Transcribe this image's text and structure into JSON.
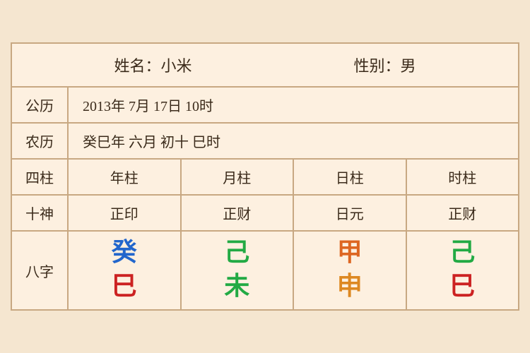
{
  "header": {
    "name_label": "姓名：小米",
    "gender_label": "性别：男"
  },
  "calendar": {
    "gongli_label": "公历",
    "gongli_value": "2013年 7月 17日 10时",
    "nongli_label": "农历",
    "nongli_value": "癸巳年 六月 初十 巳时"
  },
  "sizhu": {
    "label": "四柱",
    "cols": [
      "年柱",
      "月柱",
      "日柱",
      "时柱"
    ]
  },
  "shishen": {
    "label": "十神",
    "cols": [
      "正印",
      "正财",
      "日元",
      "正财"
    ]
  },
  "bazi": {
    "label": "八字",
    "cols": [
      {
        "top": "癸",
        "bottom": "巳",
        "top_color": "blue",
        "bottom_color": "red"
      },
      {
        "top": "己",
        "bottom": "未",
        "top_color": "green",
        "bottom_color": "green"
      },
      {
        "top": "甲",
        "bottom": "申",
        "top_color": "orange",
        "bottom_color": "orange"
      },
      {
        "top": "己",
        "bottom": "巳",
        "top_color": "green2",
        "bottom_color": "red2"
      }
    ]
  }
}
